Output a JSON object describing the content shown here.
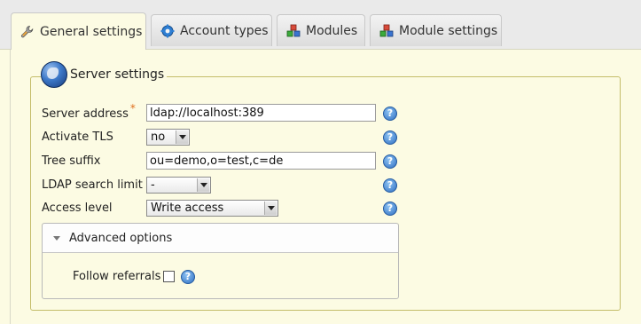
{
  "tabs": [
    {
      "label": "General settings",
      "icon": "wrench-icon",
      "active": true
    },
    {
      "label": "Account types",
      "icon": "gear-icon",
      "active": false
    },
    {
      "label": "Modules",
      "icon": "modules-icon",
      "active": false
    },
    {
      "label": "Module settings",
      "icon": "modules-icon",
      "active": false
    }
  ],
  "server_settings": {
    "legend": "Server settings",
    "legend_icon": "globe-icon",
    "fields": {
      "server_address": {
        "label": "Server address",
        "required_marker": "*",
        "value": "ldap://localhost:389"
      },
      "activate_tls": {
        "label": "Activate TLS",
        "value": "no"
      },
      "tree_suffix": {
        "label": "Tree suffix",
        "value": "ou=demo,o=test,c=de"
      },
      "search_limit": {
        "label": "LDAP search limit",
        "value": "-"
      },
      "access_level": {
        "label": "Access level",
        "value": "Write access"
      }
    },
    "help_icon": "?",
    "advanced": {
      "title": "Advanced options",
      "follow_referrals": {
        "label": "Follow referrals",
        "checked": false
      }
    }
  },
  "colors": {
    "panel_background": "#fcfbe3",
    "fieldset_border": "#c4bd6a",
    "required": "#e07020",
    "help": "#2f6fc2"
  }
}
